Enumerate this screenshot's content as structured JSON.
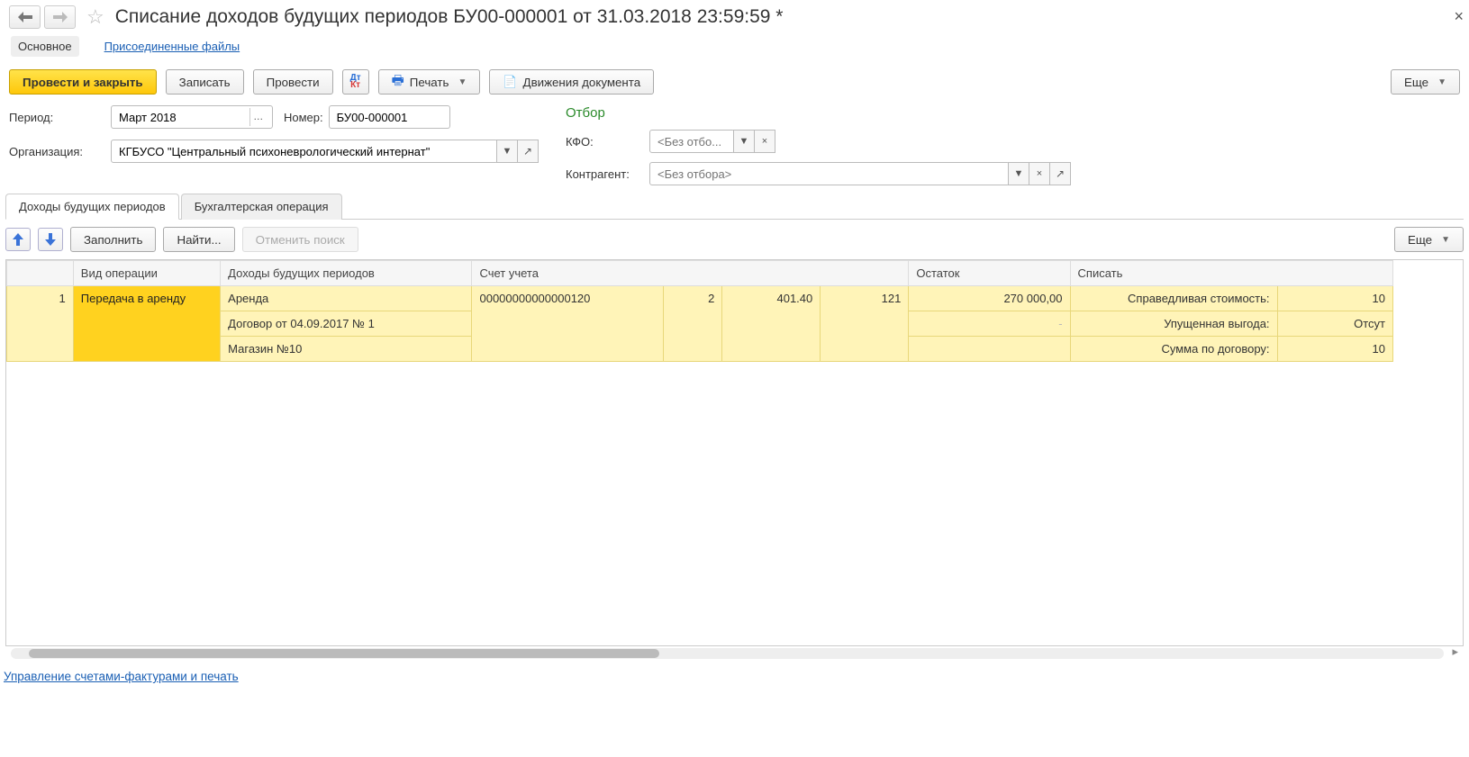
{
  "title": "Списание доходов будущих периодов БУ00-000001 от 31.03.2018 23:59:59 *",
  "top_tabs": {
    "main": "Основное",
    "files": "Присоединенные файлы"
  },
  "toolbar": {
    "post_close": "Провести и закрыть",
    "save": "Записать",
    "post": "Провести",
    "print": "Печать",
    "moves": "Движения документа",
    "more": "Еще"
  },
  "form": {
    "period_label": "Период:",
    "period_value": "Март 2018",
    "number_label": "Номер:",
    "number_value": "БУ00-000001",
    "org_label": "Организация:",
    "org_value": "КГБУСО \"Центральный психоневрологический интернат\"",
    "filter_header": "Отбор",
    "kfo_label": "КФО:",
    "kfo_placeholder": "<Без отбо...",
    "counterparty_label": "Контрагент:",
    "counterparty_placeholder": "<Без отбора>"
  },
  "tabs2": {
    "t1": "Доходы будущих периодов",
    "t2": "Бухгалтерская операция"
  },
  "panel_toolbar": {
    "fill": "Заполнить",
    "find": "Найти...",
    "cancel_find": "Отменить поиск",
    "more": "Еще"
  },
  "table": {
    "headers": {
      "op": "Вид операции",
      "dbp": "Доходы будущих периодов",
      "account": "Счет учета",
      "balance": "Остаток",
      "writeoff": "Списать"
    },
    "row1": {
      "n": "1",
      "op": "Передача в аренду",
      "l1": "Аренда",
      "l2": "Договор от 04.09.2017 № 1",
      "l3": "Магазин №10",
      "acc_full": "00000000000000120",
      "acc_c2": "2",
      "acc_c3": "401.40",
      "acc_c4": "121",
      "balance": "270 000,00",
      "balance2": "-",
      "w1_label": "Справедливая стоимость:",
      "w1_val": "10",
      "w2_label": "Упущенная выгода:",
      "w2_val": "Отсут",
      "w3_label": "Сумма по договору:",
      "w3_val": "10"
    }
  },
  "bottom_link": "Управление счетами-фактурами и печать"
}
